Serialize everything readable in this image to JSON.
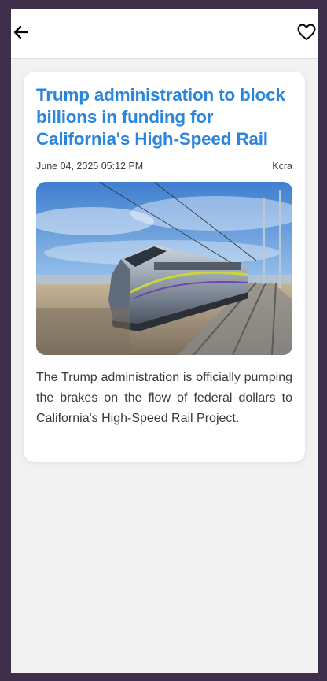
{
  "article": {
    "title": "Trump administration to block billions in funding for California's High-Speed Rail",
    "date": "June 04, 2025 05:12 PM",
    "source": "Kcra",
    "summary": "The Trump administration is officially pumping the brakes on the flow of federal dollars to California's High-Speed Rail Project."
  },
  "icons": {
    "back": "arrow-left",
    "favorite": "heart-outline"
  },
  "colors": {
    "title": "#2a86dc",
    "frame": "#3f2f4a",
    "background": "#f2f2f3"
  }
}
